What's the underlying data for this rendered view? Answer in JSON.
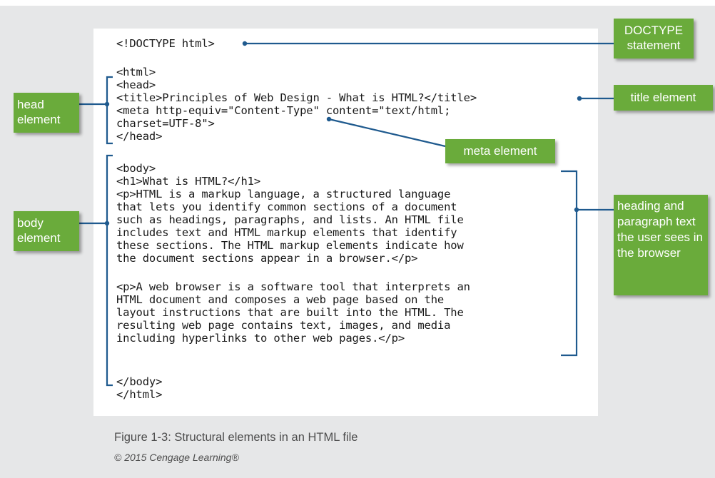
{
  "code_lines": [
    "<!DOCTYPE html>",
    "<html>",
    "<head>",
    "<title>Principles of Web Design - What is HTML?</title>",
    "<meta http-equiv=\"Content-Type\" content=\"text/html;",
    "charset=UTF-8\">",
    "</head>",
    "<body>",
    "<h1>What is HTML?</h1>",
    "<p>HTML is a markup language, a structured language",
    "that lets you identify common sections of a document",
    "such as headings, paragraphs, and lists. An HTML file",
    "includes text and HTML markup elements that identify",
    "these sections. The HTML markup elements indicate how",
    "the document sections appear in a browser.</p>",
    "<p>A web browser is a software tool that interprets an",
    "HTML document and composes a web page based on the",
    "layout instructions that are built into the HTML. The",
    "resulting web page contains text, images, and media",
    "including hyperlinks to other web pages.</p>",
    "</body>",
    "</html>"
  ],
  "callouts": {
    "doctype": "DOCTYPE statement",
    "title": "title element",
    "meta": "meta element",
    "head": "head element",
    "body": "body element",
    "heading": "heading and paragraph text the user sees in the browser"
  },
  "caption": "Figure 1-3: Structural elements in an HTML file",
  "credit": "© 2015 Cengage Learning®",
  "colors": {
    "callout_fill": "#6aab3b",
    "connector": "#1f5a8e",
    "background": "#e6e7e8"
  }
}
